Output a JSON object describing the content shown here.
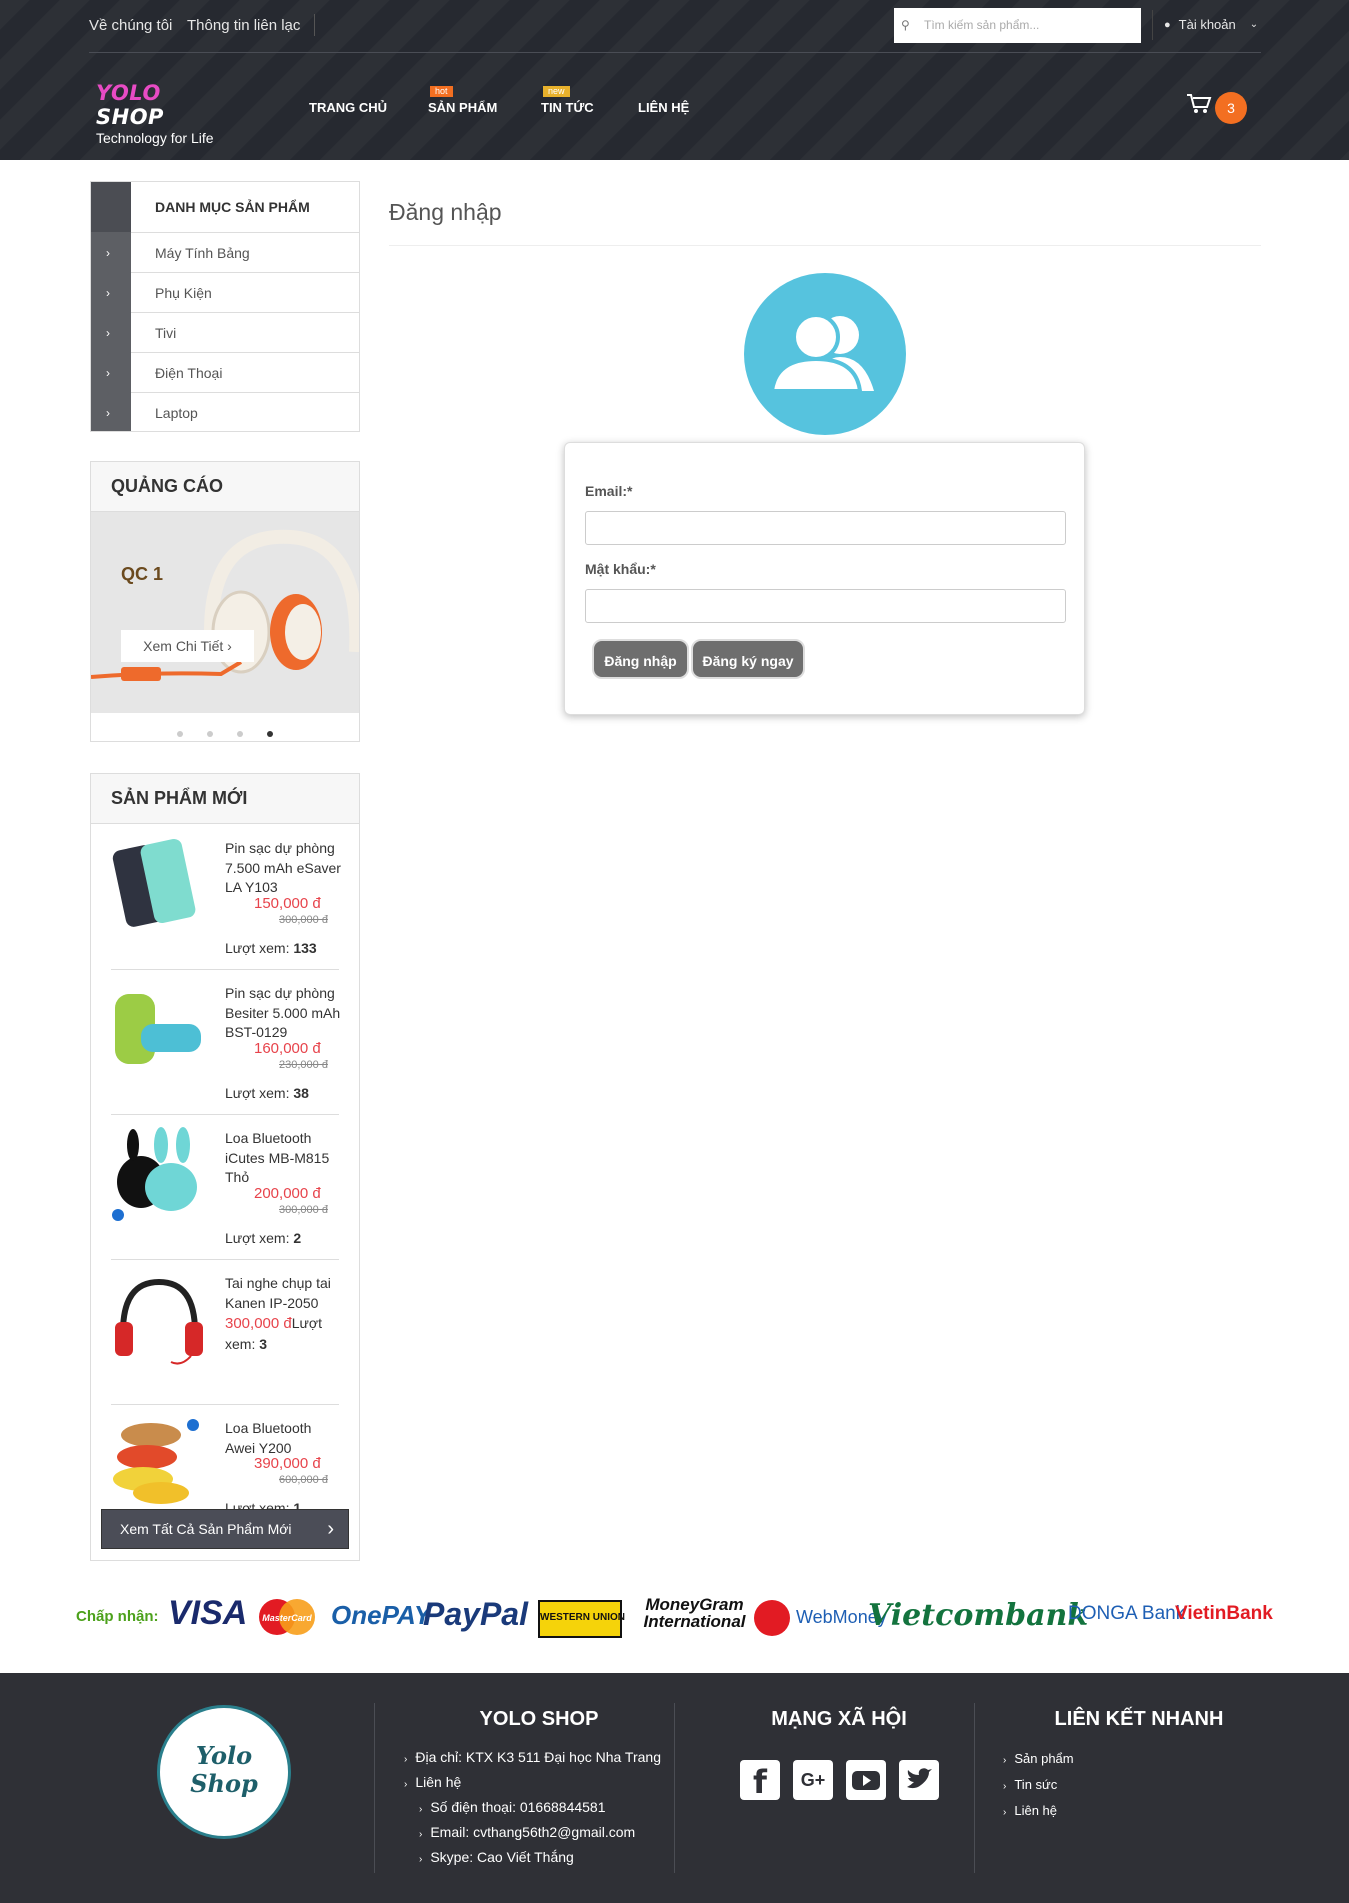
{
  "header": {
    "top_links": [
      "Về chúng tôi",
      "Thông tin liên lạc"
    ],
    "search_placeholder": "Tìm kiếm sản phẩm...",
    "account_label": "Tài khoản",
    "logo_yolo": "YOLO",
    "logo_shop": "SHOP",
    "logo_tagline": "Technology for Life",
    "nav": [
      {
        "label": "TRANG CHỦ",
        "badge": ""
      },
      {
        "label": "SẢN PHẨM",
        "badge": "hot"
      },
      {
        "label": "TIN TỨC",
        "badge": "new"
      },
      {
        "label": "LIÊN HỆ",
        "badge": ""
      }
    ],
    "cart_count": "3"
  },
  "sidebar": {
    "category_title": "DANH MỤC SẢN PHẨM",
    "categories": [
      "Máy Tính Bảng",
      "Phụ Kiện",
      "Tivi",
      "Điện Thoại",
      "Laptop"
    ],
    "ad_title": "QUẢNG CÁO",
    "ad_slide_title": "QC 1",
    "ad_button": "Xem Chi Tiết",
    "new_title": "SẢN PHẨM MỚI",
    "products": [
      {
        "name": "Pin sạc dự phòng 7.500 mAh eSaver LA Y103",
        "price": "150,000 đ",
        "old_price": "300,000 đ",
        "views_label": "Lượt xem:",
        "views": "133"
      },
      {
        "name": "Pin sạc dự phòng Besiter 5.000 mAh BST-0129",
        "price": "160,000 đ",
        "old_price": "230,000 đ",
        "views_label": "Lượt xem:",
        "views": "38"
      },
      {
        "name": "Loa Bluetooth iCutes MB-M815 Thỏ",
        "price": "200,000 đ",
        "old_price": "300,000 đ",
        "views_label": "Lượt xem:",
        "views": "2"
      },
      {
        "name": "Tai nghe chụp tai Kanen IP-2050",
        "price": "300,000 đ",
        "old_price": "",
        "views_label": "Lượt xem:",
        "views": "3"
      },
      {
        "name": "Loa Bluetooth Awei Y200",
        "price": "390,000 đ",
        "old_price": "600,000 đ",
        "views_label": "Lượt xem:",
        "views": "1"
      }
    ],
    "see_all": "Xem Tất Cả Sản Phẩm Mới"
  },
  "main": {
    "page_title": "Đăng nhập",
    "email_label": "Email:*",
    "password_label": "Mật khẩu:*",
    "email_value": "",
    "password_value": "",
    "login_button": "Đăng nhập",
    "register_button": "Đăng ký ngay"
  },
  "payments": {
    "label": "Chấp nhận:",
    "methods": [
      "VISA",
      "MasterCard",
      "OnePAY",
      "PayPal",
      "WESTERN UNION",
      "MoneyGram International",
      "WebMoney",
      "Vietcombank",
      "DONGA Bank",
      "VietinBank"
    ]
  },
  "footer": {
    "logo_line1": "Yolo",
    "logo_line2": "Shop",
    "col1_title": "YOLO SHOP",
    "address": "Địa chỉ: KTX K3 511 Đại học Nha Trang",
    "contact": "Liên hệ",
    "phone": "Số điện thoại: 01668844581",
    "email": "Email: cvthang56th2@gmail.com",
    "skype": "Skype: Cao Viết Thắng",
    "col2_title": "MẠNG XÃ HỘI",
    "col3_title": "LIÊN KẾT NHANH",
    "quick_links": [
      "Sản phẩm",
      "Tin sức",
      "Liên hệ"
    ]
  },
  "colors": {
    "accent_orange": "#f36f21",
    "avatar_blue": "#56c3de",
    "price_red": "#e7434b",
    "header_dark": "#262930",
    "footer_dark": "#2f3036"
  }
}
